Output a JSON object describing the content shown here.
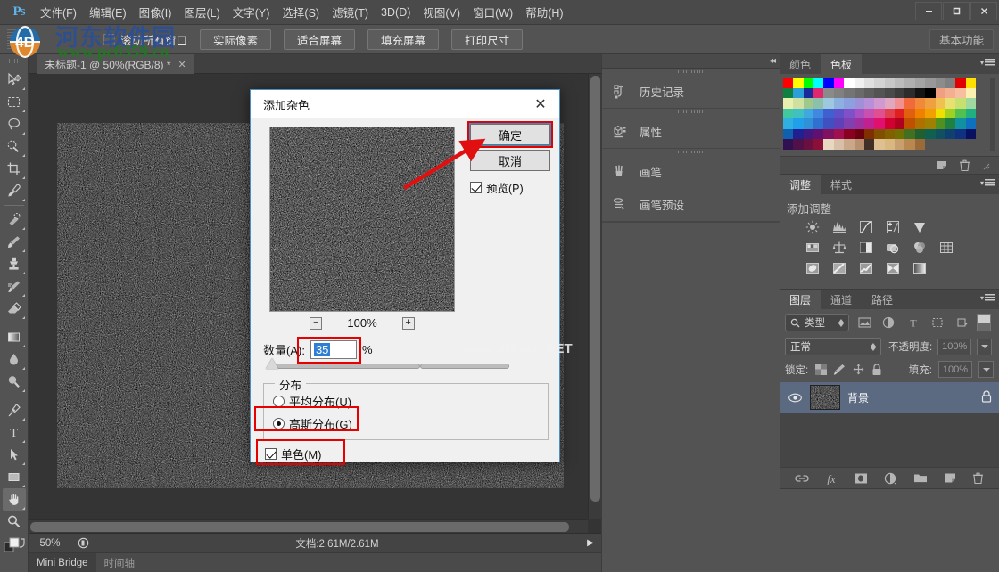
{
  "app": {
    "logo": "Ps",
    "menus": [
      {
        "label": "文件(F)"
      },
      {
        "label": "编辑(E)"
      },
      {
        "label": "图像(I)"
      },
      {
        "label": "图层(L)"
      },
      {
        "label": "文字(Y)"
      },
      {
        "label": "选择(S)"
      },
      {
        "label": "滤镜(T)"
      },
      {
        "label": "3D(D)"
      },
      {
        "label": "视图(V)"
      },
      {
        "label": "窗口(W)"
      },
      {
        "label": "帮助(H)"
      }
    ],
    "window_controls": {
      "minimize": "—",
      "maximize": "❐",
      "close": "✕"
    }
  },
  "options_bar": {
    "scroll_all_windows": "滚动所有窗口",
    "buttons": [
      {
        "label": "实际像素"
      },
      {
        "label": "适合屏幕"
      },
      {
        "label": "填充屏幕"
      },
      {
        "label": "打印尺寸"
      }
    ],
    "workspace": "基本功能"
  },
  "toolbar": {
    "tools": [
      {
        "name": "move-tool"
      },
      {
        "name": "rectangular-marquee-tool"
      },
      {
        "name": "lasso-tool"
      },
      {
        "name": "quick-selection-tool"
      },
      {
        "name": "crop-tool"
      },
      {
        "name": "eyedropper-tool"
      },
      {
        "name": "spot-healing-brush-tool"
      },
      {
        "name": "brush-tool"
      },
      {
        "name": "clone-stamp-tool"
      },
      {
        "name": "history-brush-tool"
      },
      {
        "name": "eraser-tool"
      },
      {
        "name": "gradient-tool"
      },
      {
        "name": "blur-tool"
      },
      {
        "name": "dodge-tool"
      },
      {
        "name": "pen-tool"
      },
      {
        "name": "type-tool"
      },
      {
        "name": "path-selection-tool"
      },
      {
        "name": "rectangle-tool"
      },
      {
        "name": "hand-tool"
      },
      {
        "name": "zoom-tool"
      }
    ]
  },
  "document": {
    "tab_title": "未标题-1 @ 50%(RGB/8) *",
    "close_glyph": "✕",
    "watermark": "www.pHome.NET"
  },
  "status_bar": {
    "zoom": "50%",
    "doc_info": "文档:2.61M/2.61M",
    "arrow": "▶"
  },
  "bottom_bar": {
    "tabs": [
      {
        "label": "Mini Bridge",
        "selected": true
      },
      {
        "label": "时间轴",
        "selected": false
      }
    ]
  },
  "icon_dock": {
    "collapse_glyph": "◂◂",
    "groups": [
      {
        "items": [
          {
            "label": "历史记录",
            "icon": "history-icon"
          }
        ]
      },
      {
        "items": [
          {
            "label": "属性",
            "icon": "properties-icon"
          }
        ]
      },
      {
        "items": [
          {
            "label": "画笔",
            "icon": "brush-icon"
          },
          {
            "label": "画笔预设",
            "icon": "brush-presets-icon"
          }
        ]
      }
    ]
  },
  "panels": {
    "color": {
      "tabs": [
        {
          "label": "颜色",
          "selected": false
        },
        {
          "label": "色板",
          "selected": true
        }
      ],
      "swatch_rows": [
        [
          "#ff0000",
          "#ffff00",
          "#00ff00",
          "#00ffff",
          "#0000ff",
          "#ff00ff",
          "#ffffff",
          "#f0f0f0",
          "#e0e0e0",
          "#d4d4d4",
          "#c8c8c8",
          "#bcbcbc",
          "#b0b0b0",
          "#a4a4a4",
          "#989898",
          "#8c8c8c",
          "#808080",
          "#e00000",
          "#ffe000"
        ],
        [
          "#108040",
          "#2a9fd8",
          "#1a2a9a",
          "#e0266e",
          "#8a8a8a",
          "#808080",
          "#747474",
          "#6a6a6a",
          "#5e5e5e",
          "#545454",
          "#4a4a4a",
          "#3c3c3c",
          "#2c2c2c",
          "#141414",
          "#000000",
          "#f0a080",
          "#f2b090",
          "#f6c0a0",
          "#faf0b0"
        ],
        [
          "#e8f0b0",
          "#d0e0a0",
          "#9ec88c",
          "#8cc0a8",
          "#9ec8e0",
          "#8cb0e0",
          "#8ca0e0",
          "#a090d8",
          "#b890d8",
          "#d09ad0",
          "#e0a8c0",
          "#f09090",
          "#f06a3a",
          "#f08a3a",
          "#f0a040",
          "#f0c050",
          "#e8e070",
          "#c8e070",
          "#a0d8a0"
        ],
        [
          "#40c8a0",
          "#40c0c0",
          "#40a8e0",
          "#4088e0",
          "#4060d0",
          "#6050c8",
          "#8050c8",
          "#a850c0",
          "#c850b0",
          "#e05090",
          "#e04050",
          "#e02020",
          "#e06010",
          "#f08000",
          "#f0a000",
          "#f0e000",
          "#a0d020",
          "#50c050",
          "#20b080"
        ],
        [
          "#30b0e0",
          "#20a0e8",
          "#3090d8",
          "#3070d0",
          "#4050c0",
          "#6040b8",
          "#8040b0",
          "#a030a0",
          "#c02090",
          "#e01070",
          "#d00030",
          "#b00020",
          "#c05000",
          "#b07000",
          "#a08000",
          "#509020",
          "#208040",
          "#1090a0",
          "#1070c0"
        ],
        [
          "#1060b0",
          "#202090",
          "#401880",
          "#601070",
          "#801060",
          "#a01050",
          "#8a0020",
          "#6a0010",
          "#803000",
          "#805000",
          "#806000",
          "#707000",
          "#407020",
          "#206030",
          "#106050",
          "#105060",
          "#104070",
          "#103080",
          "#0a1060"
        ],
        [
          "#301050",
          "#501048",
          "#6a1040",
          "#8a1038",
          "#e8d8c0",
          "#d8c0a8",
          "#c8a888",
          "#b89070",
          "#403028",
          "#e0c090",
          "#d8b880",
          "#c8a070",
          "#b88850",
          "#9a6a38",
          "#535353",
          "#535353",
          "#535353",
          "#535353",
          "#535353"
        ]
      ]
    },
    "adjustments": {
      "tabs": [
        {
          "label": "调整",
          "selected": true
        },
        {
          "label": "样式",
          "selected": false
        }
      ],
      "title": "添加调整",
      "icons": [
        [
          "brightness-contrast-icon",
          "levels-icon",
          "curves-icon",
          "exposure-icon",
          "vibrance-icon"
        ],
        [
          "hue-saturation-icon",
          "color-balance-icon",
          "black-white-icon",
          "photo-filter-icon",
          "channel-mixer-icon",
          "color-lookup-icon"
        ],
        [
          "invert-icon",
          "posterize-icon",
          "threshold-icon",
          "selective-color-icon",
          "gradient-map-icon"
        ]
      ]
    },
    "layers": {
      "tabs": [
        {
          "label": "图层",
          "selected": true
        },
        {
          "label": "通道",
          "selected": false
        },
        {
          "label": "路径",
          "selected": false
        }
      ],
      "filter_label": "类型",
      "filter_icons": [
        "pixel-filter-icon",
        "adjustment-filter-icon",
        "type-filter-icon",
        "shape-filter-icon",
        "smartobject-filter-icon"
      ],
      "blend_mode": "正常",
      "opacity_label": "不透明度:",
      "opacity_value": "100%",
      "lock_label": "锁定:",
      "fill_label": "填充:",
      "fill_value": "100%",
      "rows": [
        {
          "name": "背景",
          "locked": true,
          "visible": true
        }
      ],
      "footer_icons": [
        "link-layers-icon",
        "layer-style-icon",
        "layer-mask-icon",
        "new-adjustment-icon",
        "new-group-icon",
        "new-layer-icon",
        "delete-layer-icon"
      ]
    }
  },
  "dialog": {
    "title": "添加杂色",
    "close_glyph": "✕",
    "ok_label": "确定",
    "cancel_label": "取消",
    "preview_label": "预览(P)",
    "zoom_out": "−",
    "zoom_in": "+",
    "zoom_level": "100%",
    "amount_label": "数量(A):",
    "amount_value": "35",
    "amount_unit": "%",
    "distribution_legend": "分布",
    "uniform_label": "平均分布(U)",
    "gaussian_label": "高斯分布(G)",
    "monochrome_label": "单色(M)",
    "selected_distribution": "gaussian",
    "monochrome_checked": true,
    "preview_checked": true,
    "highlight_color": "#e60000",
    "arrow_color": "#e11010"
  },
  "watermarks": {
    "site_cn": "河东软件园",
    "site_url": "www.pc0359.cn",
    "canvas": "www.pHome.NET"
  }
}
